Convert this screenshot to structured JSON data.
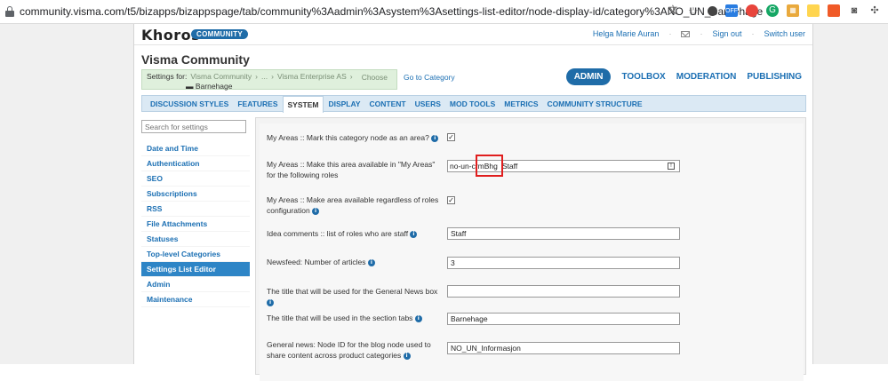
{
  "browser": {
    "url": "community.visma.com/t5/bizapps/bizappspage/tab/community%3Aadmin%3Asystem%3Asettings-list-editor/node-display-id/category%3ANO_UN_Barnehage"
  },
  "header": {
    "logo": "Khoros",
    "badge": "COMMUNITY",
    "user": "Helga Marie Auran",
    "sign_out": "Sign out",
    "switch_user": "Switch user"
  },
  "page_title": "Visma Community",
  "settings_for": {
    "label": "Settings for:",
    "crumb1": "Visma Community",
    "crumb_ellipsis": "...",
    "crumb2": "Visma Enterprise AS",
    "choose": "Choose",
    "node": "Barnehage"
  },
  "go_to_category": "Go to Category",
  "topnav": {
    "admin": "ADMIN",
    "toolbox": "TOOLBOX",
    "moderation": "MODERATION",
    "publishing": "PUBLISHING"
  },
  "tabs": [
    "DISCUSSION STYLES",
    "FEATURES",
    "SYSTEM",
    "DISPLAY",
    "CONTENT",
    "USERS",
    "MOD TOOLS",
    "METRICS",
    "COMMUNITY STRUCTURE"
  ],
  "active_tab": "SYSTEM",
  "sidebar": {
    "search_placeholder": "Search for settings",
    "items": [
      "Date and Time",
      "Authentication",
      "SEO",
      "Subscriptions",
      "RSS",
      "File Attachments",
      "Statuses",
      "Top-level Categories",
      "Settings List Editor",
      "Admin",
      "Maintenance"
    ],
    "active": "Settings List Editor"
  },
  "settings": [
    {
      "label": "My Areas :: Mark this category node as an area?",
      "type": "checkbox",
      "checked": true
    },
    {
      "label": "My Areas :: Make this area available in \"My Areas\" for the following roles",
      "type": "tags",
      "tag": "no-un-crmBhg",
      "typed": "Staff"
    },
    {
      "label": "My Areas :: Make area available regardless of roles configuration",
      "type": "checkbox",
      "checked": true
    },
    {
      "label": "Idea comments :: list of roles who are staff",
      "type": "text",
      "value": "Staff"
    },
    {
      "label": "Newsfeed: Number of articles",
      "type": "text",
      "value": "3"
    },
    {
      "label": "The title that will be used for the General News box",
      "type": "text",
      "value": ""
    },
    {
      "label": "The title that will be used in the section tabs",
      "type": "text",
      "value": "Barnehage"
    },
    {
      "label": "General news: Node ID for the blog node used to share content across product categories",
      "type": "text",
      "value": "NO_UN_Informasjon"
    }
  ],
  "colors": {
    "accent": "#1f6ca8",
    "link": "#1b6fb3",
    "settings_bg": "#dff0dc",
    "highlight": "#e01e1e"
  }
}
